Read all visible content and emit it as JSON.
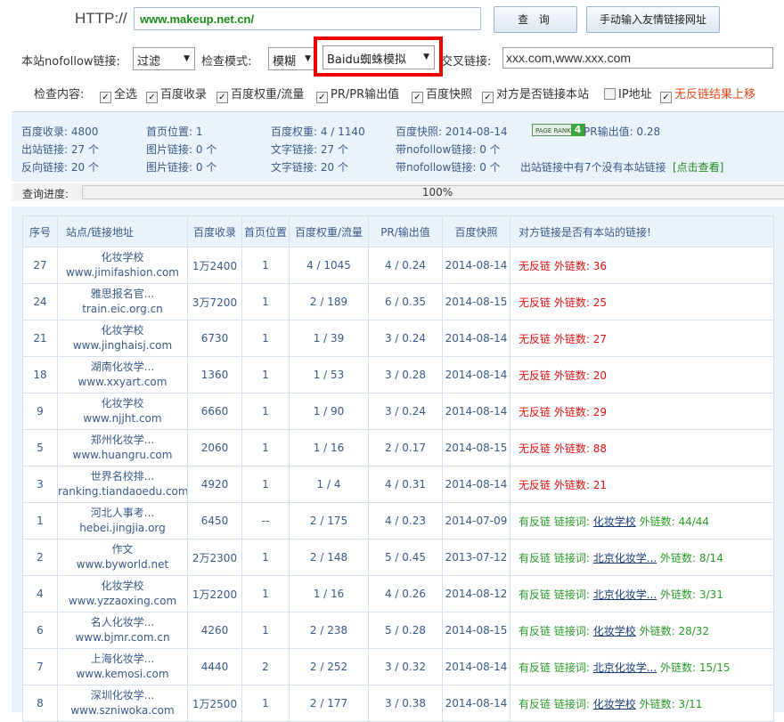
{
  "url_bar": {
    "label": "HTTP://",
    "value": "www.makeup.net.cn/"
  },
  "buttons": {
    "query": "查 询",
    "manual": "手动输入友情链接网址"
  },
  "options": {
    "nofollow_label": "本站nofollow链接:",
    "nofollow_value": "过滤",
    "mode_label": "检查模式:",
    "mode_value": "模糊",
    "spider_value": "Baidu蜘蛛模拟",
    "cross_label": "交叉链接:",
    "cross_value": "xxx.com,www.xxx.com"
  },
  "check_content": {
    "label": "检查内容:",
    "items": [
      {
        "label": "全选",
        "checked": true
      },
      {
        "label": "百度收录",
        "checked": true
      },
      {
        "label": "百度权重/流量",
        "checked": true
      },
      {
        "label": "PR/PR输出值",
        "checked": true
      },
      {
        "label": "百度快照",
        "checked": true
      },
      {
        "label": "对方是否链接本站",
        "checked": true
      },
      {
        "label": "IP地址",
        "checked": false
      },
      {
        "label": "无反链结果上移",
        "checked": true
      }
    ]
  },
  "stats": {
    "baidu_index": "百度收录: 4800",
    "home_pos": "首页位置: 1",
    "baidu_weight": "百度权重: 4 / 1140",
    "baidu_snapshot": "百度快照: 2014-08-14",
    "pagerank_text": "PAGE RANK",
    "pagerank_value": "4",
    "pr_output": "PR输出值: 0.28",
    "out_links": "出站链接: 27 个",
    "img_links_1": "图片链接: 0 个",
    "text_links_1": "文字链接: 27 个",
    "nofollow_1": "带nofollow链接: 0 个",
    "back_links": "反向链接: 20 个",
    "img_links_2": "图片链接: 0 个",
    "text_links_2": "文字链接: 20 个",
    "nofollow_2": "带nofollow链接: 0 个",
    "out_notice": "出站链接中有7个没有本站链接",
    "view_link": "[点击查看]"
  },
  "progress": {
    "label": "查询进度:",
    "value_text": "100%",
    "fraction": 1.0
  },
  "table": {
    "headers": [
      "序号",
      "站点/链接地址",
      "百度收录",
      "首页位置",
      "百度权重/流量",
      "PR/输出值",
      "百度快照",
      "对方链接是否有本站的链接!"
    ],
    "rows": [
      {
        "no": "27",
        "name": "化妆学校",
        "url": "www.jimifashion.com",
        "index": "1万2400",
        "home": "1",
        "weight": "4 / 1045",
        "pr": "4 / 0.24",
        "snap": "2014-08-14",
        "snap_old": false,
        "has_link": false,
        "status": "无反链",
        "out_label": "外链数:",
        "out_count": "36"
      },
      {
        "no": "24",
        "name": "雅思报名官...",
        "url": "train.eic.org.cn",
        "index": "3万7200",
        "home": "1",
        "weight": "2 / 189",
        "pr": "6 / 0.35",
        "snap": "2014-08-15",
        "snap_old": false,
        "has_link": false,
        "status": "无反链",
        "out_label": "外链数:",
        "out_count": "25"
      },
      {
        "no": "21",
        "name": "化妆学校",
        "url": "www.jinghaisj.com",
        "index": "6730",
        "home": "1",
        "weight": "1 / 39",
        "pr": "3 / 0.24",
        "snap": "2014-08-14",
        "snap_old": false,
        "has_link": false,
        "status": "无反链",
        "out_label": "外链数:",
        "out_count": "27"
      },
      {
        "no": "18",
        "name": "湖南化妆学...",
        "url": "www.xxyart.com",
        "index": "1360",
        "home": "1",
        "weight": "1 / 53",
        "pr": "3 / 0.28",
        "snap": "2014-08-14",
        "snap_old": false,
        "has_link": false,
        "status": "无反链",
        "out_label": "外链数:",
        "out_count": "20"
      },
      {
        "no": "9",
        "name": "化妆学校",
        "url": "www.njjht.com",
        "index": "6660",
        "home": "1",
        "weight": "1 / 90",
        "pr": "3 / 0.24",
        "snap": "2014-08-14",
        "snap_old": false,
        "has_link": false,
        "status": "无反链",
        "out_label": "外链数:",
        "out_count": "29"
      },
      {
        "no": "5",
        "name": "郑州化妆学...",
        "url": "www.huangru.com",
        "index": "2060",
        "home": "1",
        "weight": "1 / 16",
        "pr": "2 / 0.17",
        "snap": "2014-08-15",
        "snap_old": false,
        "has_link": false,
        "status": "无反链",
        "out_label": "外链数:",
        "out_count": "88"
      },
      {
        "no": "3",
        "name": "世界名校排...",
        "url": "ranking.tiandaoedu.com",
        "index": "4920",
        "home": "1",
        "weight": "1 / 4",
        "pr": "4 / 0.31",
        "snap": "2014-08-14",
        "snap_old": false,
        "has_link": false,
        "status": "无反链",
        "out_label": "外链数:",
        "out_count": "21"
      },
      {
        "no": "1",
        "name": "河北人事考...",
        "url": "hebei.jingjia.org",
        "index": "6450",
        "home": "--",
        "weight": "2 / 175",
        "pr": "4 / 0.23",
        "snap": "2014-07-09",
        "snap_old": true,
        "has_link": true,
        "status": "有反链",
        "anchor_label": "链接词:",
        "anchor": "化妆学校",
        "out_label": "外链数:",
        "out_count": "44/44"
      },
      {
        "no": "2",
        "name": "作文",
        "url": "www.byworld.net",
        "index": "2万2300",
        "home": "1",
        "weight": "2 / 148",
        "pr": "5 / 0.45",
        "snap": "2013-07-12",
        "snap_old": true,
        "has_link": true,
        "status": "有反链",
        "anchor_label": "链接词:",
        "anchor": "北京化妆学...",
        "out_label": "外链数:",
        "out_count": "8/14"
      },
      {
        "no": "4",
        "name": "化妆学校",
        "url": "www.yzzaoxing.com",
        "index": "1万2200",
        "home": "1",
        "weight": "1 / 16",
        "pr": "4 / 0.26",
        "snap": "2014-08-12",
        "snap_old": false,
        "has_link": true,
        "status": "有反链",
        "anchor_label": "链接词:",
        "anchor": "北京化妆学...",
        "out_label": "外链数:",
        "out_count": "3/31"
      },
      {
        "no": "6",
        "name": "名人化妆学...",
        "url": "www.bjmr.com.cn",
        "index": "4260",
        "home": "1",
        "weight": "2 / 238",
        "pr": "5 / 0.28",
        "snap": "2014-08-15",
        "snap_old": false,
        "has_link": true,
        "status": "有反链",
        "anchor_label": "链接词:",
        "anchor": "化妆学校",
        "out_label": "外链数:",
        "out_count": "28/32"
      },
      {
        "no": "7",
        "name": "上海化妆学...",
        "url": "www.kemosi.com",
        "index": "4440",
        "home": "2",
        "weight": "2 / 252",
        "pr": "3 / 0.32",
        "snap": "2014-08-14",
        "snap_old": false,
        "has_link": true,
        "status": "有反链",
        "anchor_label": "链接词:",
        "anchor": "北京化妆学...",
        "out_label": "外链数:",
        "out_count": "15/15"
      },
      {
        "no": "8",
        "name": "深圳化妆学...",
        "url": "www.szniwoka.com",
        "index": "1万2500",
        "home": "1",
        "weight": "2 / 177",
        "pr": "3 / 0.38",
        "snap": "2014-08-14",
        "snap_old": false,
        "has_link": true,
        "status": "有反链",
        "anchor_label": "链接词:",
        "anchor": "化妆学校",
        "out_label": "外链数:",
        "out_count": "3/11"
      }
    ]
  },
  "colors": {
    "url_green": "#1a8a1a",
    "highlight_red": "#ee0000",
    "no_link_red": "#e01010",
    "has_link_green": "#2a9a2a",
    "header_blue": "#3a5a86",
    "panel_bg": "#eaf2fa"
  }
}
